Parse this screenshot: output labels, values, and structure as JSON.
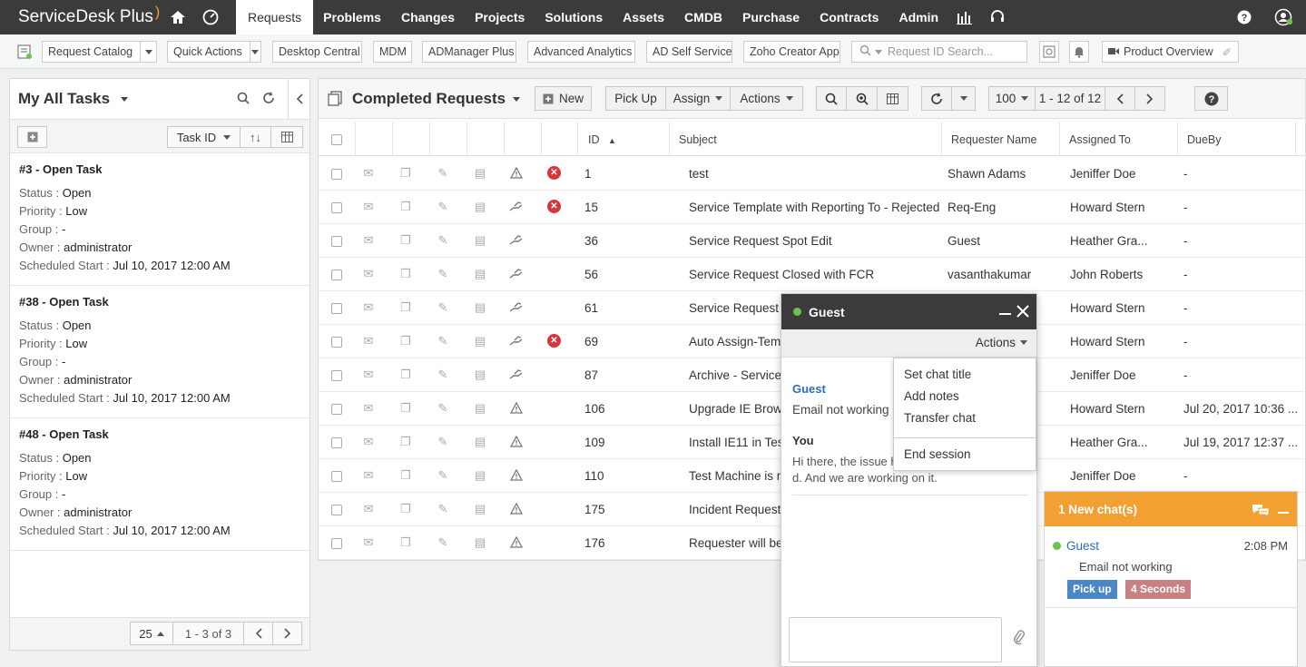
{
  "app": {
    "logo": "ServiceDesk Plus"
  },
  "nav": {
    "tabs": [
      "Requests",
      "Problems",
      "Changes",
      "Projects",
      "Solutions",
      "Assets",
      "CMDB",
      "Purchase",
      "Contracts",
      "Admin"
    ]
  },
  "toolbar2": {
    "request_catalog": "Request Catalog",
    "quick_actions": "Quick Actions",
    "desktop_central": "Desktop Central",
    "mdm": "MDM",
    "admanager": "ADManager Plus",
    "advanced_analytics": "Advanced Analytics",
    "ad_self_service": "AD Self Service",
    "zoho_creator": "Zoho Creator App",
    "search_placeholder": "Request ID Search...",
    "product_overview": "Product Overview"
  },
  "left": {
    "title": "My All Tasks",
    "sort_label": "Task ID",
    "labels": {
      "status": "Status :",
      "priority": "Priority :",
      "group": "Group :",
      "owner": "Owner :",
      "sched": "Scheduled Start :"
    },
    "tasks": [
      {
        "title": "#3 - Open Task",
        "status": "Open",
        "priority": "Low",
        "group": "-",
        "owner": "administrator",
        "sched": "Jul 10, 2017 12:00 AM"
      },
      {
        "title": "#38 - Open Task",
        "status": "Open",
        "priority": "Low",
        "group": "-",
        "owner": "administrator",
        "sched": "Jul 10, 2017 12:00 AM"
      },
      {
        "title": "#48 - Open Task",
        "status": "Open",
        "priority": "Low",
        "group": "-",
        "owner": "administrator",
        "sched": "Jul 10, 2017 12:00 AM"
      }
    ],
    "per_page": "25",
    "range": "1 - 3 of  3"
  },
  "main": {
    "title": "Completed Requests",
    "new_label": "New",
    "pickup_label": "Pick Up",
    "assign_label": "Assign",
    "actions_label": "Actions",
    "per_page": "100",
    "range": "1 - 12 of 12",
    "columns": {
      "id": "ID",
      "subject": "Subject",
      "requester": "Requester Name",
      "assigned": "Assigned To",
      "dueby": "DueBy"
    },
    "rows": [
      {
        "id": "1",
        "subject": "test",
        "requester": "Shawn Adams",
        "assigned": "Jeniffer Doe",
        "due": "-",
        "rejected": true,
        "kind": "incident"
      },
      {
        "id": "15",
        "subject": "Service Template with Reporting To - Rejected",
        "requester": "Req-Eng",
        "assigned": "Howard Stern",
        "due": "-",
        "rejected": true,
        "kind": "service"
      },
      {
        "id": "36",
        "subject": "Service Request Spot Edit",
        "requester": "Guest",
        "assigned": "Heather Gra...",
        "due": "-",
        "rejected": false,
        "kind": "service"
      },
      {
        "id": "56",
        "subject": "Service Request Closed with FCR",
        "requester": "vasanthakumar",
        "assigned": "John Roberts",
        "due": "-",
        "rejected": false,
        "kind": "service"
      },
      {
        "id": "61",
        "subject": "Service Request -",
        "requester": "",
        "assigned": "Howard Stern",
        "due": "-",
        "rejected": false,
        "kind": "service"
      },
      {
        "id": "69",
        "subject": "Auto Assign-Tem",
        "requester": "",
        "assigned": "Howard Stern",
        "due": "-",
        "rejected": true,
        "kind": "service"
      },
      {
        "id": "87",
        "subject": "Archive - Service",
        "requester": "",
        "assigned": "Jeniffer Doe",
        "due": "-",
        "rejected": false,
        "kind": "service"
      },
      {
        "id": "106",
        "subject": "Upgrade IE Brows",
        "requester": "",
        "assigned": "Howard Stern",
        "due": "Jul 20, 2017 10:36 ...",
        "rejected": false,
        "kind": "incident"
      },
      {
        "id": "109",
        "subject": "Install IE11 in Tes",
        "requester": "",
        "assigned": "Heather Gra...",
        "due": "Jul 19, 2017 12:37 ...",
        "rejected": false,
        "kind": "incident"
      },
      {
        "id": "110",
        "subject": "Test Machine is n",
        "requester": "",
        "assigned": "Jeniffer Doe",
        "due": "-",
        "rejected": false,
        "kind": "incident"
      },
      {
        "id": "175",
        "subject": "Incident Request",
        "requester": "",
        "assigned": "",
        "due": "",
        "rejected": false,
        "kind": "incident"
      },
      {
        "id": "176",
        "subject": "Requester will be",
        "requester": "",
        "assigned": "",
        "due": "",
        "rejected": false,
        "kind": "incident"
      }
    ]
  },
  "chat": {
    "name": "Guest",
    "actions_label": "Actions",
    "msg1_sender": "Guest",
    "msg1_text": "Email not working",
    "msg2_sender": "You",
    "msg2_line1": "Hi there, the issue h",
    "msg2_line2": "d. And we are working on it.",
    "menu": [
      "Set chat title",
      "Add notes",
      "Transfer chat",
      "End session"
    ]
  },
  "new_chats": {
    "title": "1 New chat(s)",
    "name": "Guest",
    "time": "2:08 PM",
    "message": "Email not working",
    "pickup": "Pick up",
    "elapsed": "4 Seconds"
  },
  "colors": {
    "topbar": "#3b3b3b",
    "orange": "#f3a033",
    "online": "#6cc24a",
    "rejected": "#d9343a",
    "pickup_badge": "#4a87c4",
    "elapsed_badge": "#c98080"
  }
}
